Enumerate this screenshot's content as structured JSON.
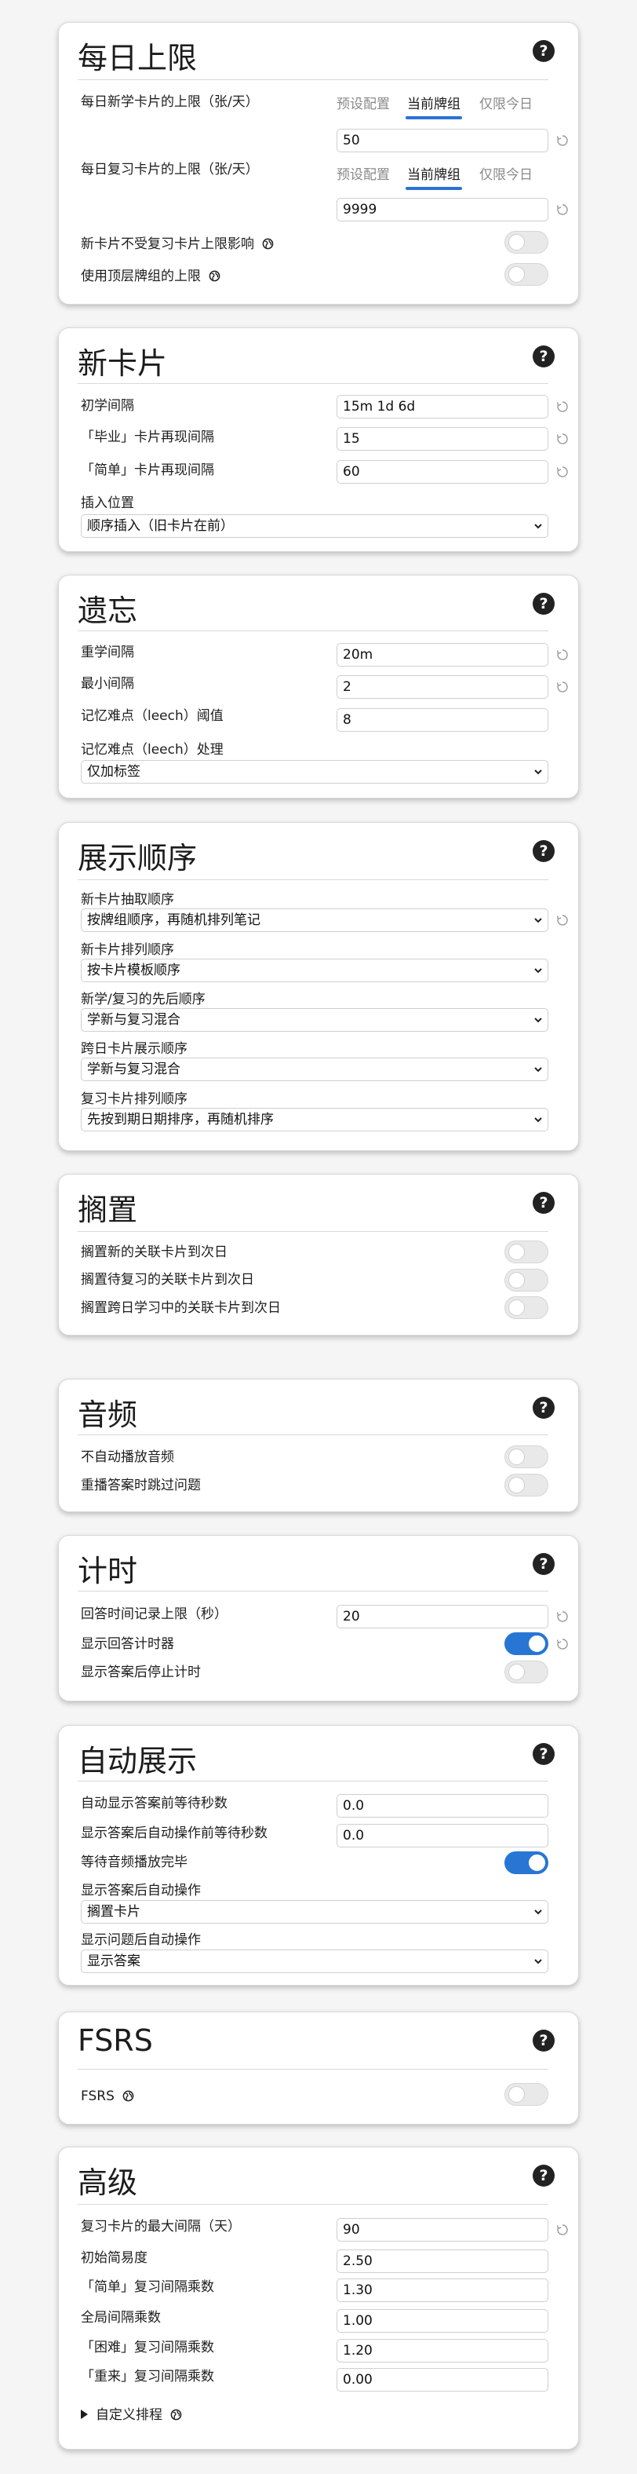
{
  "daily_limits": {
    "title": "每日上限",
    "new_limit_label": "每日新学卡片的上限（张/天）",
    "review_limit_label": "每日复习卡片的上限（张/天）",
    "tabs": [
      "预设配置",
      "当前牌组",
      "仅限今日"
    ],
    "active_tab": "当前牌组",
    "new_limit_value": "50",
    "review_limit_value": "9999",
    "new_ignore_review_label": "新卡片不受复习卡片上限影响",
    "new_ignore_review_on": false,
    "top_deck_limit_label": "使用顶层牌组的上限",
    "top_deck_limit_on": false
  },
  "new_cards": {
    "title": "新卡片",
    "learning_steps_label": "初学间隔",
    "learning_steps_value": "15m 1d 6d",
    "graduating_label": "「毕业」卡片再现间隔",
    "graduating_value": "15",
    "easy_label": "「简单」卡片再现间隔",
    "easy_value": "60",
    "insertion_label": "插入位置",
    "insertion_value": "顺序插入（旧卡片在前）"
  },
  "lapses": {
    "title": "遗忘",
    "relearning_label": "重学间隔",
    "relearning_value": "20m",
    "min_interval_label": "最小间隔",
    "min_interval_value": "2",
    "leech_threshold_label": "记忆难点（leech）阈值",
    "leech_threshold_value": "8",
    "leech_action_label": "记忆难点（leech）处理",
    "leech_action_value": "仅加标签"
  },
  "display_order": {
    "title": "展示顺序",
    "gather_label": "新卡片抽取顺序",
    "gather_value": "按牌组顺序，再随机排列笔记",
    "sort_label": "新卡片排列顺序",
    "sort_value": "按卡片模板顺序",
    "new_review_label": "新学/复习的先后顺序",
    "new_review_value": "学新与复习混合",
    "interday_label": "跨日卡片展示顺序",
    "interday_value": "学新与复习混合",
    "review_sort_label": "复习卡片排列顺序",
    "review_sort_value": "先按到期日期排序，再随机排序"
  },
  "burying": {
    "title": "搁置",
    "bury_new_label": "搁置新的关联卡片到次日",
    "bury_review_label": "搁置待复习的关联卡片到次日",
    "bury_interday_label": "搁置跨日学习中的关联卡片到次日",
    "bury_new_on": false,
    "bury_review_on": false,
    "bury_interday_on": false
  },
  "audio": {
    "title": "音频",
    "no_autoplay_label": "不自动播放音频",
    "skip_question_label": "重播答案时跳过问题",
    "no_autoplay_on": false,
    "skip_question_on": false
  },
  "timer": {
    "title": "计时",
    "max_answer_label": "回答时间记录上限（秒）",
    "max_answer_value": "20",
    "show_timer_label": "显示回答计时器",
    "show_timer_on": true,
    "stop_timer_label": "显示答案后停止计时",
    "stop_timer_on": false
  },
  "auto_advance": {
    "title": "自动展示",
    "seconds_answer_label": "自动显示答案前等待秒数",
    "seconds_answer_value": "0.0",
    "seconds_question_label": "显示答案后自动操作前等待秒数",
    "seconds_question_value": "0.0",
    "wait_audio_label": "等待音频播放完毕",
    "wait_audio_on": true,
    "answer_action_label": "显示答案后自动操作",
    "answer_action_value": "搁置卡片",
    "question_action_label": "显示问题后自动操作",
    "question_action_value": "显示答案"
  },
  "fsrs": {
    "title": "FSRS",
    "fsrs_label": "FSRS",
    "fsrs_on": false
  },
  "advanced": {
    "title": "高级",
    "max_interval_label": "复习卡片的最大间隔（天）",
    "max_interval_value": "90",
    "starting_ease_label": "初始简易度",
    "starting_ease_value": "2.50",
    "easy_bonus_label": "「简单」复习间隔乘数",
    "easy_bonus_value": "1.30",
    "interval_modifier_label": "全局间隔乘数",
    "interval_modifier_value": "1.00",
    "hard_interval_label": "「困难」复习间隔乘数",
    "hard_interval_value": "1.20",
    "new_interval_label": "「重来」复习间隔乘数",
    "new_interval_value": "0.00",
    "custom_scheduling_label": "自定义排程"
  },
  "help_glyph": "?",
  "icons": [
    "help-icon",
    "globe-icon",
    "revert-icon",
    "chevron-down-icon",
    "disclosure-triangle-icon"
  ],
  "colors": {
    "accent": "#2b72d6",
    "toggle_on": "#2776d4",
    "background": "#f5f5f5"
  }
}
